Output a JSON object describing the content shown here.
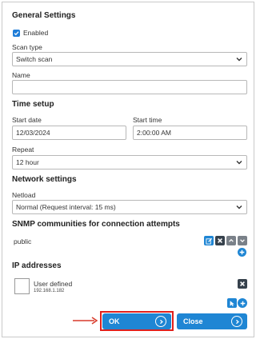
{
  "general": {
    "heading": "General Settings",
    "enabled_label": "Enabled",
    "enabled_checked": true,
    "scan_type_label": "Scan type",
    "scan_type_value": "Switch scan",
    "name_label": "Name",
    "name_value": ""
  },
  "time": {
    "heading": "Time setup",
    "start_date_label": "Start date",
    "start_date_value": "12/03/2024",
    "start_time_label": "Start time",
    "start_time_value": "2:00:00 AM",
    "repeat_label": "Repeat",
    "repeat_value": "12 hour"
  },
  "network": {
    "heading": "Network settings",
    "netload_label": "Netload",
    "netload_value": "Normal (Request interval: 15 ms)"
  },
  "snmp": {
    "heading": "SNMP communities for connection attempts",
    "items": [
      "public"
    ]
  },
  "ip": {
    "heading": "IP addresses",
    "entry_title": "User defined",
    "entry_address": "192.168.1.182"
  },
  "footer": {
    "ok_label": "OK",
    "close_label": "Close"
  },
  "colors": {
    "accent": "#1f86d4",
    "highlight": "#e0201b"
  }
}
